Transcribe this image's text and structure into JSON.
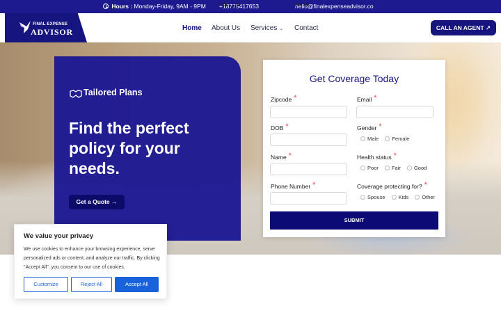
{
  "topbar": {
    "hours_label": "Hours :",
    "hours_value": "Monday-Friday, 9AM - 9PM",
    "call_label": "CALL US:",
    "call_value": "+18775417653",
    "email_label": "EMAIL :",
    "email_value": "hello@finalexpenseadvisor.co"
  },
  "logo": {
    "top_line": "FINAL EXPENSE",
    "main_line": "ADVISOR"
  },
  "nav": {
    "home": "Home",
    "about": "About Us",
    "services": "Services",
    "contact": "Contact"
  },
  "agent_button": "CALL AN AGENT",
  "hero": {
    "badge": "Tailored Plans",
    "title": "Find the perfect policy for your needs.",
    "quote_button": "Get a Quote"
  },
  "form": {
    "title": "Get Coverage Today",
    "zipcode_label": "Zipcode",
    "email_label": "Email",
    "dob_label": "DOB",
    "gender_label": "Gender",
    "gender_options": [
      "Male",
      "Female"
    ],
    "name_label": "Name",
    "health_label": "Health status",
    "health_options": [
      "Poor",
      "Fair",
      "Good"
    ],
    "phone_label": "Phone Number",
    "coverage_label": "Coverage protecting for?",
    "coverage_options": [
      "Spouse",
      "Kids",
      "Other"
    ],
    "required_mark": "*",
    "submit": "SUBMIT"
  },
  "cookie": {
    "title": "We value your privacy",
    "text": "We use cookies to enhance your browsing experience, serve personalized ads or content, and analyze our traffic. By clicking \"Accept All\", you consent to our use of cookies.",
    "customize": "Customize",
    "reject": "Reject All",
    "accept": "Accept All"
  },
  "colors": {
    "brand": "#16147f",
    "button_blue": "#1863dc",
    "required": "#e14b4b"
  }
}
